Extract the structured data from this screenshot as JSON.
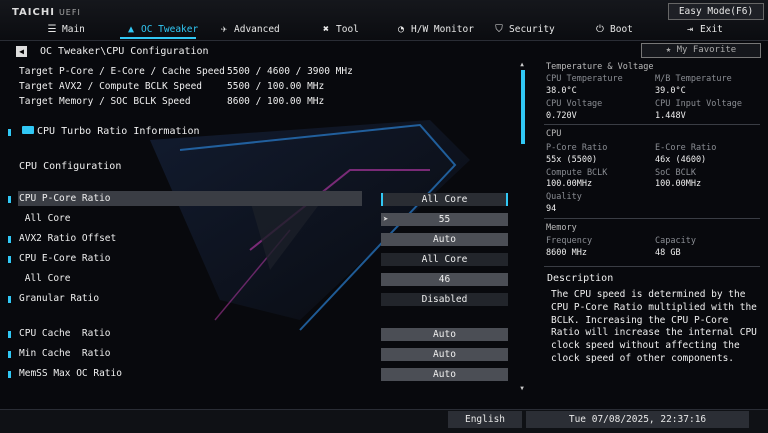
{
  "brand": {
    "name": "TAICHI",
    "sub": "UEFI"
  },
  "header": {
    "easy_mode_label": "Easy Mode(F6)",
    "tabs": [
      {
        "label": "Main",
        "icon": "menu-icon"
      },
      {
        "label": "OC Tweaker",
        "icon": "rocket-icon",
        "active": true
      },
      {
        "label": "Advanced",
        "icon": "plane-icon"
      },
      {
        "label": "Tool",
        "icon": "tools-icon"
      },
      {
        "label": "H/W Monitor",
        "icon": "monitor-gauge-icon"
      },
      {
        "label": "Security",
        "icon": "shield-icon"
      },
      {
        "label": "Boot",
        "icon": "power-icon"
      },
      {
        "label": "Exit",
        "icon": "exit-door-icon"
      }
    ]
  },
  "breadcrumb": "OC Tweaker\\CPU Configuration",
  "targets": [
    {
      "label": "Target P-Core / E-Core / Cache Speed",
      "value": "5500 / 4600 / 3900 MHz"
    },
    {
      "label": "Target AVX2 / Compute BCLK Speed",
      "value": "5500 / 100.00 MHz"
    },
    {
      "label": "Target Memory / SOC BCLK Speed",
      "value": "8600 / 100.00 MHz"
    }
  ],
  "turbo_link": "CPU Turbo Ratio Information",
  "section_title": "CPU Configuration",
  "settings": [
    {
      "label": "CPU P-Core Ratio",
      "value": "All Core",
      "marker": true
    },
    {
      "label": " All Core",
      "value": "55",
      "marker": false
    },
    {
      "label": "AVX2 Ratio Offset",
      "value": "Auto",
      "marker": true
    },
    {
      "label": "CPU E-Core Ratio",
      "value": "All Core",
      "marker": true
    },
    {
      "label": " All Core",
      "value": "46",
      "marker": false
    },
    {
      "label": "Granular Ratio",
      "value": "Disabled",
      "marker": true
    },
    {
      "label": "CPU Cache  Ratio",
      "value": "Auto",
      "marker": true
    },
    {
      "label": "Min Cache  Ratio",
      "value": "Auto",
      "marker": true
    },
    {
      "label": "MemSS Max OC Ratio",
      "value": "Auto",
      "marker": true
    }
  ],
  "favorite_label": "★ My Favorite",
  "monitor": {
    "tv_title": "Temperature & Voltage",
    "cpu_temp_label": "CPU Temperature",
    "cpu_temp": "38.0°C",
    "mb_temp_label": "M/B Temperature",
    "mb_temp": "39.0°C",
    "cpu_volt_label": "CPU Voltage",
    "cpu_volt": "0.720V",
    "cpu_input_label": "CPU Input Voltage",
    "cpu_input": "1.448V",
    "cpu_title": "CPU",
    "pcore_label": "P-Core Ratio",
    "pcore": "55x (5500)",
    "ecore_label": "E-Core Ratio",
    "ecore": "46x (4600)",
    "cbclk_label": "Compute BCLK",
    "cbclk": "100.00MHz",
    "soc_label": "SoC BCLK",
    "soc": "100.00MHz",
    "quality_label": "Quality",
    "quality": "94",
    "mem_title": "Memory",
    "freq_label": "Frequency",
    "freq": "8600 MHz",
    "cap_label": "Capacity",
    "cap": "48 GB"
  },
  "description": {
    "title": "Description",
    "text": "The CPU speed is determined by the CPU P-Core Ratio multiplied with the BCLK. Increasing the CPU P-Core Ratio will increase the internal CPU clock speed without affecting the clock speed of other components."
  },
  "footer": {
    "language": "English",
    "datetime": "Tue 07/08/2025, 22:37:16"
  },
  "colors": {
    "accent": "#31c8f5",
    "bar": "#4b4e55"
  }
}
